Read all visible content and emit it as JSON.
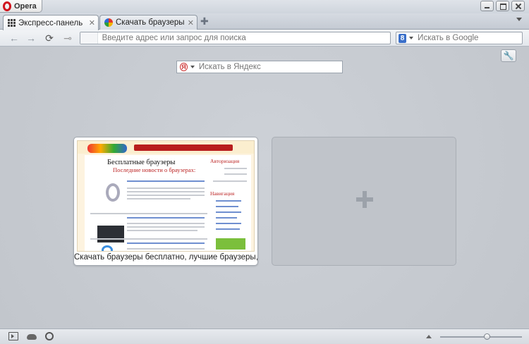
{
  "window": {
    "app_button_label": "Opera"
  },
  "tabs": [
    {
      "label": "Экспресс-панель",
      "icon": "speed-dial-grid-icon",
      "active": true
    },
    {
      "label": "Скачать браузеры бес...",
      "icon": "site-favicon",
      "active": false
    }
  ],
  "navbar": {
    "address_placeholder": "Введите адрес или запрос для поиска",
    "search_placeholder": "Искать в Google",
    "search_engine_icon": "google-icon"
  },
  "speed_dial": {
    "search_placeholder": "Искать в Яндекс",
    "search_engine_icon": "yandex-icon",
    "entries": [
      {
        "caption": "Скачать браузеры бесплатно, лучшие браузеры, ...",
        "thumbnail": {
          "heading": "Бесплатные браузеры",
          "subheading": "Последние новости о браузерах:",
          "sidebar_title_1": "Авторизация",
          "sidebar_title_2": "Навигация"
        }
      },
      {
        "caption": "",
        "empty": true,
        "icon": "plus-icon"
      }
    ]
  },
  "statusbar": {
    "zoom_level": 0.58
  }
}
